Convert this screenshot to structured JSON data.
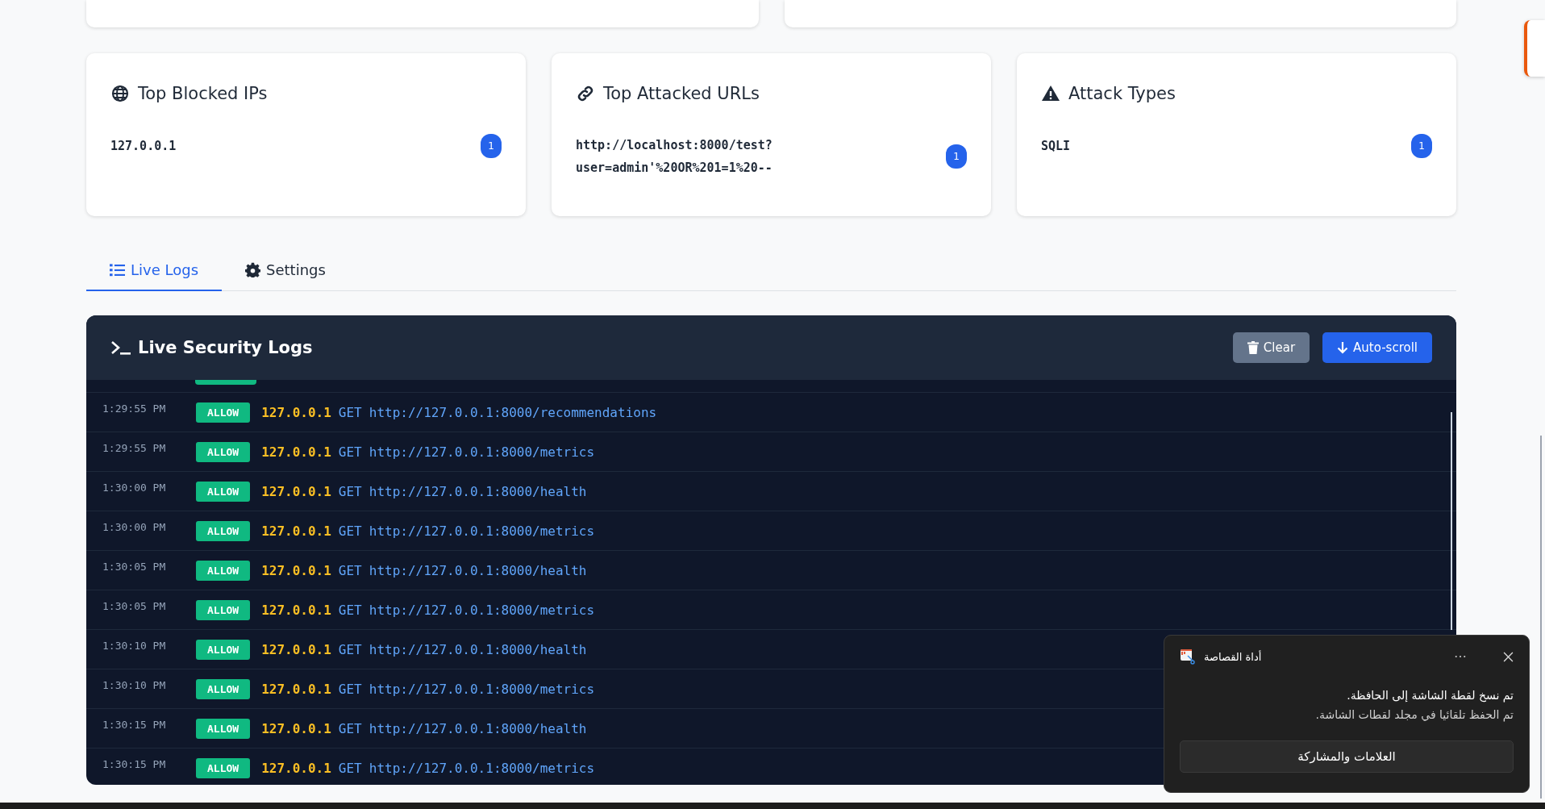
{
  "stat_cards": [
    {
      "kind": "globe",
      "title": "Top Blocked IPs",
      "items": [
        {
          "label": "127.0.0.1",
          "count": "1"
        }
      ]
    },
    {
      "kind": "link",
      "title": "Top Attacked URLs",
      "items": [
        {
          "label": "http://localhost:8000/test?user=admin'%20OR%201=1%20--",
          "count": "1"
        }
      ]
    },
    {
      "kind": "warning",
      "title": "Attack Types",
      "items": [
        {
          "label": "SQLI",
          "count": "1"
        }
      ]
    }
  ],
  "tabs": [
    {
      "label": "Live Logs",
      "kind": "list",
      "selected": true
    },
    {
      "label": "Settings",
      "kind": "gear",
      "selected": false
    }
  ],
  "logs_panel": {
    "title": "Live Security Logs",
    "buttons": [
      {
        "label": "Clear",
        "kind": "clear"
      },
      {
        "label": "Auto-scroll",
        "kind": "autoscroll"
      }
    ],
    "rows": [
      {
        "time": "1:29:55 PM",
        "action": "ALLOW",
        "ip": "127.0.0.1",
        "method": "GET",
        "url": "http://127.0.0.1:8000/recommendations"
      },
      {
        "time": "1:29:55 PM",
        "action": "ALLOW",
        "ip": "127.0.0.1",
        "method": "GET",
        "url": "http://127.0.0.1:8000/metrics"
      },
      {
        "time": "1:30:00 PM",
        "action": "ALLOW",
        "ip": "127.0.0.1",
        "method": "GET",
        "url": "http://127.0.0.1:8000/health"
      },
      {
        "time": "1:30:00 PM",
        "action": "ALLOW",
        "ip": "127.0.0.1",
        "method": "GET",
        "url": "http://127.0.0.1:8000/metrics"
      },
      {
        "time": "1:30:05 PM",
        "action": "ALLOW",
        "ip": "127.0.0.1",
        "method": "GET",
        "url": "http://127.0.0.1:8000/health"
      },
      {
        "time": "1:30:05 PM",
        "action": "ALLOW",
        "ip": "127.0.0.1",
        "method": "GET",
        "url": "http://127.0.0.1:8000/metrics"
      },
      {
        "time": "1:30:10 PM",
        "action": "ALLOW",
        "ip": "127.0.0.1",
        "method": "GET",
        "url": "http://127.0.0.1:8000/health"
      },
      {
        "time": "1:30:10 PM",
        "action": "ALLOW",
        "ip": "127.0.0.1",
        "method": "GET",
        "url": "http://127.0.0.1:8000/metrics"
      },
      {
        "time": "1:30:15 PM",
        "action": "ALLOW",
        "ip": "127.0.0.1",
        "method": "GET",
        "url": "http://127.0.0.1:8000/health"
      },
      {
        "time": "1:30:15 PM",
        "action": "ALLOW",
        "ip": "127.0.0.1",
        "method": "GET",
        "url": "http://127.0.0.1:8000/metrics"
      }
    ]
  },
  "notification": {
    "app": "أداة القصاصة",
    "lines": [
      "تم نسخ لقطة الشاشة إلى الحافظة.",
      "تم الحفظ تلقائيا في مجلد لقطات الشاشة."
    ],
    "button": "العلامات والمشاركة"
  }
}
